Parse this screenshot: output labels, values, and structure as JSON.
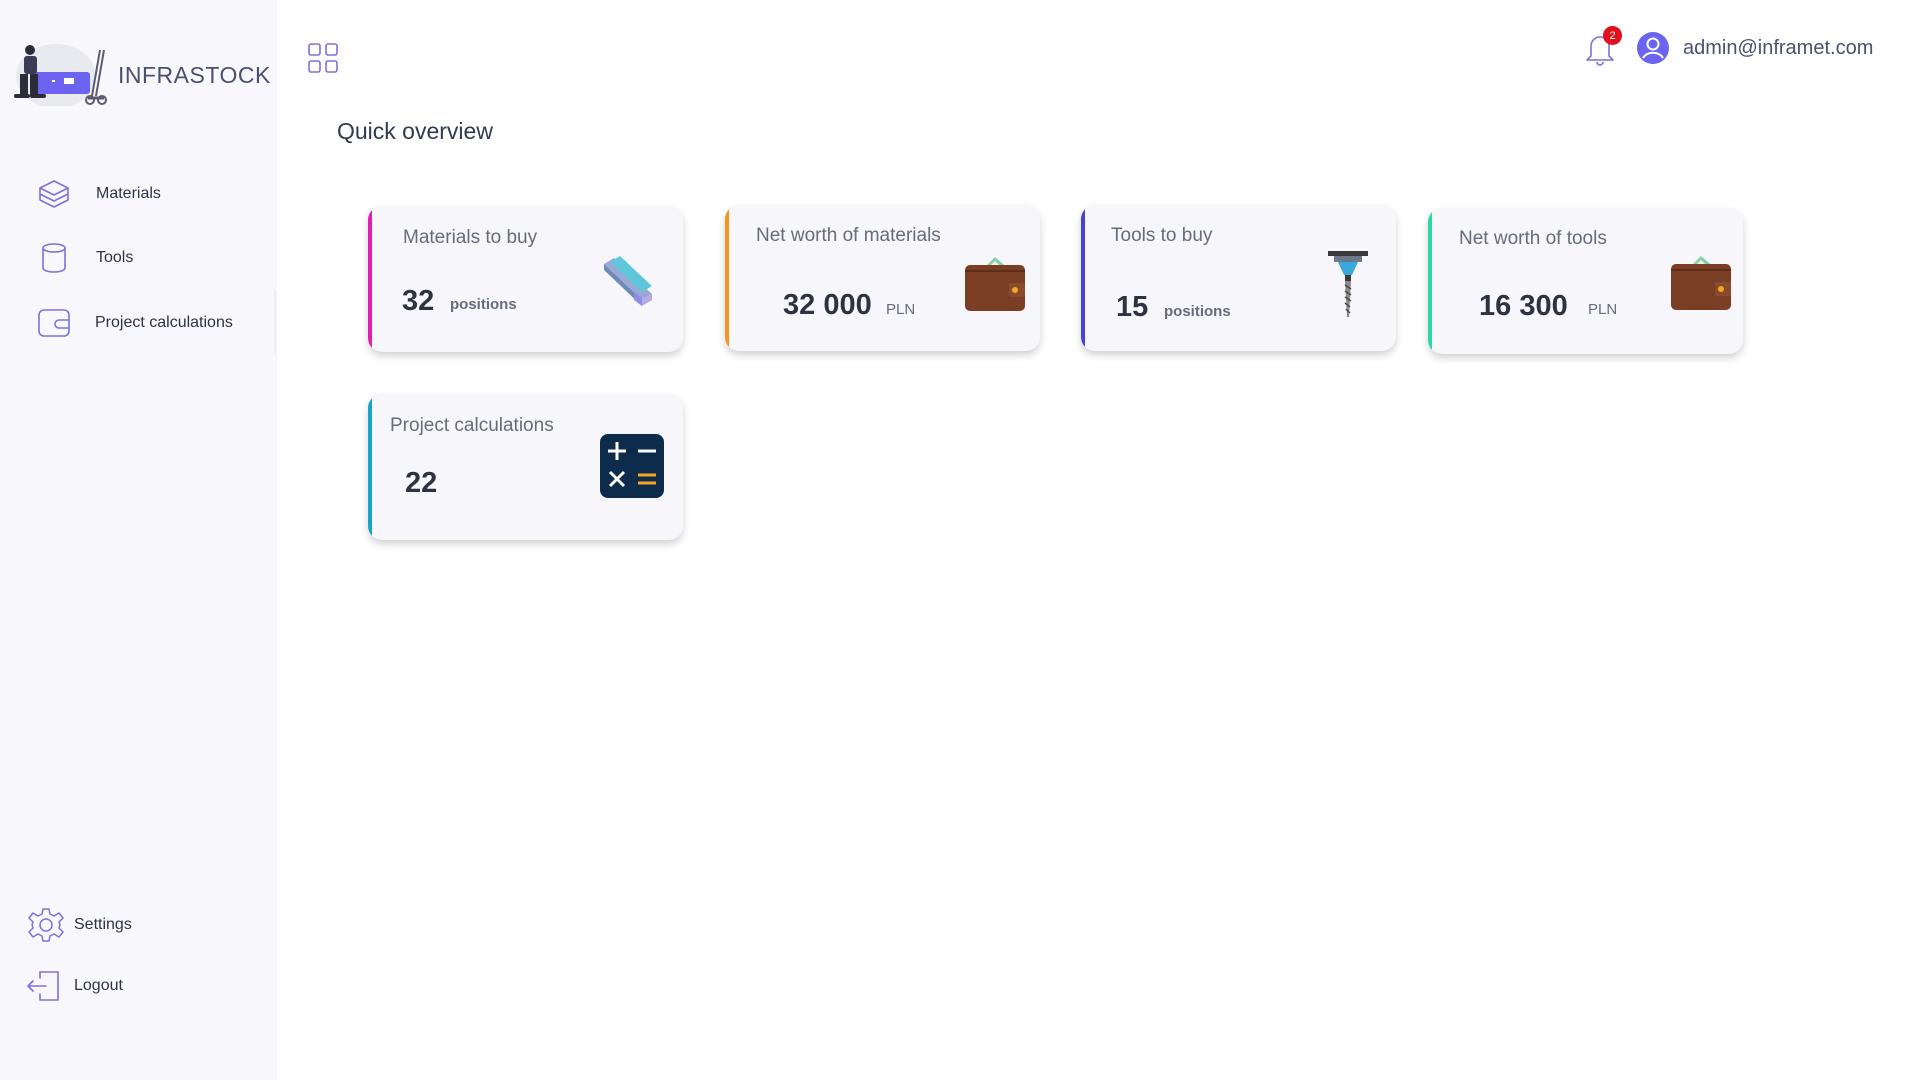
{
  "brand": {
    "name": "INFRASTOCK"
  },
  "sidebar": {
    "items": [
      {
        "label": "Materials",
        "icon": "box-stack-icon"
      },
      {
        "label": "Tools",
        "icon": "cylinder-icon"
      },
      {
        "label": "Project calculations",
        "icon": "wallet-outline-icon"
      }
    ],
    "bottom": [
      {
        "label": "Settings",
        "icon": "gear-icon"
      },
      {
        "label": "Logout",
        "icon": "logout-door-icon"
      }
    ]
  },
  "header": {
    "notifications_count": "2",
    "user_email": "admin@inframet.com"
  },
  "page": {
    "title": "Quick overview"
  },
  "cards": [
    {
      "title": "Materials to buy",
      "value": "32",
      "unit": "positions",
      "accent": "#e31cb0",
      "icon": "steel-beam-icon"
    },
    {
      "title": "Net worth of materials",
      "value": "32 000",
      "unit": "PLN",
      "accent": "#f5941e",
      "icon": "wallet-icon"
    },
    {
      "title": "Tools to buy",
      "value": "15",
      "unit": "positions",
      "accent": "#4a3fd6",
      "icon": "drill-bit-icon"
    },
    {
      "title": "Net worth of tools",
      "value": "16 300",
      "unit": "PLN",
      "accent": "#2fd6a8",
      "icon": "wallet-icon"
    },
    {
      "title": "Project calculations",
      "value": "22",
      "unit": "",
      "accent": "#1aa3c9",
      "icon": "calculator-icon"
    }
  ],
  "colors": {
    "sidebar_bg": "#f8f8fc",
    "icon_outline": "#7b72d9",
    "text_primary": "#2e3342",
    "badge": "#e3101a",
    "avatar": "#6c63f0"
  }
}
